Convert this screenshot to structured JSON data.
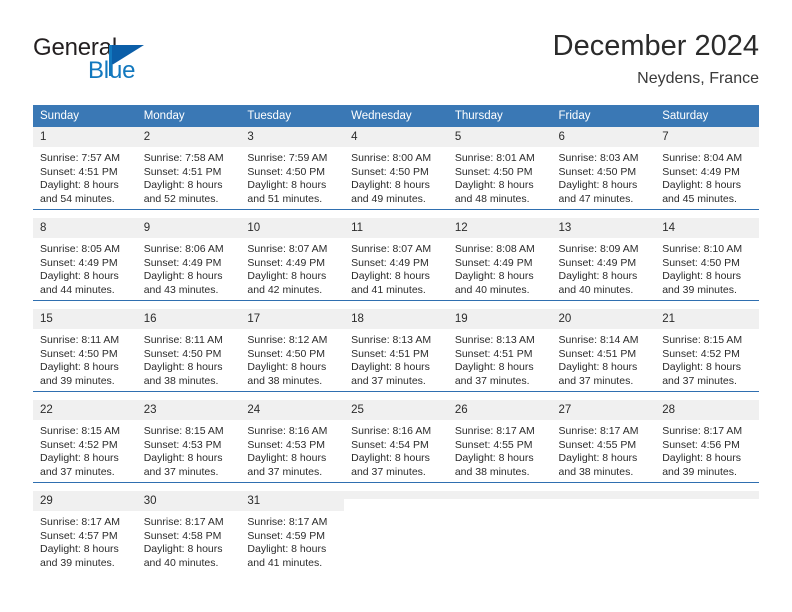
{
  "logo": {
    "word_one": "General",
    "word_two": "Blue",
    "icon": "triangle-flag-icon"
  },
  "header": {
    "month_title": "December 2024",
    "location": "Neydens, France"
  },
  "calendar": {
    "weekday_headers": [
      "Sunday",
      "Monday",
      "Tuesday",
      "Wednesday",
      "Thursday",
      "Friday",
      "Saturday"
    ],
    "accent_color": "#3a78b5",
    "separator_color": "#2f6fb0",
    "daynum_background": "#f0f0f0",
    "weeks": [
      [
        {
          "day": "1",
          "sunrise": "Sunrise: 7:57 AM",
          "sunset": "Sunset: 4:51 PM",
          "daylight_line1": "Daylight: 8 hours",
          "daylight_line2": "and 54 minutes."
        },
        {
          "day": "2",
          "sunrise": "Sunrise: 7:58 AM",
          "sunset": "Sunset: 4:51 PM",
          "daylight_line1": "Daylight: 8 hours",
          "daylight_line2": "and 52 minutes."
        },
        {
          "day": "3",
          "sunrise": "Sunrise: 7:59 AM",
          "sunset": "Sunset: 4:50 PM",
          "daylight_line1": "Daylight: 8 hours",
          "daylight_line2": "and 51 minutes."
        },
        {
          "day": "4",
          "sunrise": "Sunrise: 8:00 AM",
          "sunset": "Sunset: 4:50 PM",
          "daylight_line1": "Daylight: 8 hours",
          "daylight_line2": "and 49 minutes."
        },
        {
          "day": "5",
          "sunrise": "Sunrise: 8:01 AM",
          "sunset": "Sunset: 4:50 PM",
          "daylight_line1": "Daylight: 8 hours",
          "daylight_line2": "and 48 minutes."
        },
        {
          "day": "6",
          "sunrise": "Sunrise: 8:03 AM",
          "sunset": "Sunset: 4:50 PM",
          "daylight_line1": "Daylight: 8 hours",
          "daylight_line2": "and 47 minutes."
        },
        {
          "day": "7",
          "sunrise": "Sunrise: 8:04 AM",
          "sunset": "Sunset: 4:49 PM",
          "daylight_line1": "Daylight: 8 hours",
          "daylight_line2": "and 45 minutes."
        }
      ],
      [
        {
          "day": "8",
          "sunrise": "Sunrise: 8:05 AM",
          "sunset": "Sunset: 4:49 PM",
          "daylight_line1": "Daylight: 8 hours",
          "daylight_line2": "and 44 minutes."
        },
        {
          "day": "9",
          "sunrise": "Sunrise: 8:06 AM",
          "sunset": "Sunset: 4:49 PM",
          "daylight_line1": "Daylight: 8 hours",
          "daylight_line2": "and 43 minutes."
        },
        {
          "day": "10",
          "sunrise": "Sunrise: 8:07 AM",
          "sunset": "Sunset: 4:49 PM",
          "daylight_line1": "Daylight: 8 hours",
          "daylight_line2": "and 42 minutes."
        },
        {
          "day": "11",
          "sunrise": "Sunrise: 8:07 AM",
          "sunset": "Sunset: 4:49 PM",
          "daylight_line1": "Daylight: 8 hours",
          "daylight_line2": "and 41 minutes."
        },
        {
          "day": "12",
          "sunrise": "Sunrise: 8:08 AM",
          "sunset": "Sunset: 4:49 PM",
          "daylight_line1": "Daylight: 8 hours",
          "daylight_line2": "and 40 minutes."
        },
        {
          "day": "13",
          "sunrise": "Sunrise: 8:09 AM",
          "sunset": "Sunset: 4:49 PM",
          "daylight_line1": "Daylight: 8 hours",
          "daylight_line2": "and 40 minutes."
        },
        {
          "day": "14",
          "sunrise": "Sunrise: 8:10 AM",
          "sunset": "Sunset: 4:50 PM",
          "daylight_line1": "Daylight: 8 hours",
          "daylight_line2": "and 39 minutes."
        }
      ],
      [
        {
          "day": "15",
          "sunrise": "Sunrise: 8:11 AM",
          "sunset": "Sunset: 4:50 PM",
          "daylight_line1": "Daylight: 8 hours",
          "daylight_line2": "and 39 minutes."
        },
        {
          "day": "16",
          "sunrise": "Sunrise: 8:11 AM",
          "sunset": "Sunset: 4:50 PM",
          "daylight_line1": "Daylight: 8 hours",
          "daylight_line2": "and 38 minutes."
        },
        {
          "day": "17",
          "sunrise": "Sunrise: 8:12 AM",
          "sunset": "Sunset: 4:50 PM",
          "daylight_line1": "Daylight: 8 hours",
          "daylight_line2": "and 38 minutes."
        },
        {
          "day": "18",
          "sunrise": "Sunrise: 8:13 AM",
          "sunset": "Sunset: 4:51 PM",
          "daylight_line1": "Daylight: 8 hours",
          "daylight_line2": "and 37 minutes."
        },
        {
          "day": "19",
          "sunrise": "Sunrise: 8:13 AM",
          "sunset": "Sunset: 4:51 PM",
          "daylight_line1": "Daylight: 8 hours",
          "daylight_line2": "and 37 minutes."
        },
        {
          "day": "20",
          "sunrise": "Sunrise: 8:14 AM",
          "sunset": "Sunset: 4:51 PM",
          "daylight_line1": "Daylight: 8 hours",
          "daylight_line2": "and 37 minutes."
        },
        {
          "day": "21",
          "sunrise": "Sunrise: 8:15 AM",
          "sunset": "Sunset: 4:52 PM",
          "daylight_line1": "Daylight: 8 hours",
          "daylight_line2": "and 37 minutes."
        }
      ],
      [
        {
          "day": "22",
          "sunrise": "Sunrise: 8:15 AM",
          "sunset": "Sunset: 4:52 PM",
          "daylight_line1": "Daylight: 8 hours",
          "daylight_line2": "and 37 minutes."
        },
        {
          "day": "23",
          "sunrise": "Sunrise: 8:15 AM",
          "sunset": "Sunset: 4:53 PM",
          "daylight_line1": "Daylight: 8 hours",
          "daylight_line2": "and 37 minutes."
        },
        {
          "day": "24",
          "sunrise": "Sunrise: 8:16 AM",
          "sunset": "Sunset: 4:53 PM",
          "daylight_line1": "Daylight: 8 hours",
          "daylight_line2": "and 37 minutes."
        },
        {
          "day": "25",
          "sunrise": "Sunrise: 8:16 AM",
          "sunset": "Sunset: 4:54 PM",
          "daylight_line1": "Daylight: 8 hours",
          "daylight_line2": "and 37 minutes."
        },
        {
          "day": "26",
          "sunrise": "Sunrise: 8:17 AM",
          "sunset": "Sunset: 4:55 PM",
          "daylight_line1": "Daylight: 8 hours",
          "daylight_line2": "and 38 minutes."
        },
        {
          "day": "27",
          "sunrise": "Sunrise: 8:17 AM",
          "sunset": "Sunset: 4:55 PM",
          "daylight_line1": "Daylight: 8 hours",
          "daylight_line2": "and 38 minutes."
        },
        {
          "day": "28",
          "sunrise": "Sunrise: 8:17 AM",
          "sunset": "Sunset: 4:56 PM",
          "daylight_line1": "Daylight: 8 hours",
          "daylight_line2": "and 39 minutes."
        }
      ],
      [
        {
          "day": "29",
          "sunrise": "Sunrise: 8:17 AM",
          "sunset": "Sunset: 4:57 PM",
          "daylight_line1": "Daylight: 8 hours",
          "daylight_line2": "and 39 minutes."
        },
        {
          "day": "30",
          "sunrise": "Sunrise: 8:17 AM",
          "sunset": "Sunset: 4:58 PM",
          "daylight_line1": "Daylight: 8 hours",
          "daylight_line2": "and 40 minutes."
        },
        {
          "day": "31",
          "sunrise": "Sunrise: 8:17 AM",
          "sunset": "Sunset: 4:59 PM",
          "daylight_line1": "Daylight: 8 hours",
          "daylight_line2": "and 41 minutes."
        },
        {
          "day": "",
          "sunrise": "",
          "sunset": "",
          "daylight_line1": "",
          "daylight_line2": ""
        },
        {
          "day": "",
          "sunrise": "",
          "sunset": "",
          "daylight_line1": "",
          "daylight_line2": ""
        },
        {
          "day": "",
          "sunrise": "",
          "sunset": "",
          "daylight_line1": "",
          "daylight_line2": ""
        },
        {
          "day": "",
          "sunrise": "",
          "sunset": "",
          "daylight_line1": "",
          "daylight_line2": ""
        }
      ]
    ]
  }
}
